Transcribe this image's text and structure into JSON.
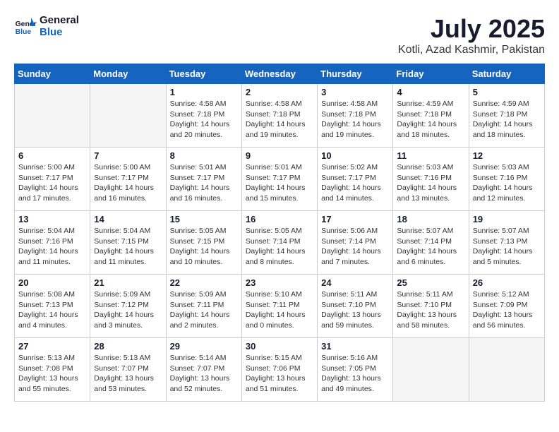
{
  "header": {
    "logo_line1": "General",
    "logo_line2": "Blue",
    "month": "July 2025",
    "location": "Kotli, Azad Kashmir, Pakistan"
  },
  "weekdays": [
    "Sunday",
    "Monday",
    "Tuesday",
    "Wednesday",
    "Thursday",
    "Friday",
    "Saturday"
  ],
  "weeks": [
    [
      {
        "day": "",
        "info": ""
      },
      {
        "day": "",
        "info": ""
      },
      {
        "day": "1",
        "info": "Sunrise: 4:58 AM\nSunset: 7:18 PM\nDaylight: 14 hours\nand 20 minutes."
      },
      {
        "day": "2",
        "info": "Sunrise: 4:58 AM\nSunset: 7:18 PM\nDaylight: 14 hours\nand 19 minutes."
      },
      {
        "day": "3",
        "info": "Sunrise: 4:58 AM\nSunset: 7:18 PM\nDaylight: 14 hours\nand 19 minutes."
      },
      {
        "day": "4",
        "info": "Sunrise: 4:59 AM\nSunset: 7:18 PM\nDaylight: 14 hours\nand 18 minutes."
      },
      {
        "day": "5",
        "info": "Sunrise: 4:59 AM\nSunset: 7:18 PM\nDaylight: 14 hours\nand 18 minutes."
      }
    ],
    [
      {
        "day": "6",
        "info": "Sunrise: 5:00 AM\nSunset: 7:17 PM\nDaylight: 14 hours\nand 17 minutes."
      },
      {
        "day": "7",
        "info": "Sunrise: 5:00 AM\nSunset: 7:17 PM\nDaylight: 14 hours\nand 16 minutes."
      },
      {
        "day": "8",
        "info": "Sunrise: 5:01 AM\nSunset: 7:17 PM\nDaylight: 14 hours\nand 16 minutes."
      },
      {
        "day": "9",
        "info": "Sunrise: 5:01 AM\nSunset: 7:17 PM\nDaylight: 14 hours\nand 15 minutes."
      },
      {
        "day": "10",
        "info": "Sunrise: 5:02 AM\nSunset: 7:17 PM\nDaylight: 14 hours\nand 14 minutes."
      },
      {
        "day": "11",
        "info": "Sunrise: 5:03 AM\nSunset: 7:16 PM\nDaylight: 14 hours\nand 13 minutes."
      },
      {
        "day": "12",
        "info": "Sunrise: 5:03 AM\nSunset: 7:16 PM\nDaylight: 14 hours\nand 12 minutes."
      }
    ],
    [
      {
        "day": "13",
        "info": "Sunrise: 5:04 AM\nSunset: 7:16 PM\nDaylight: 14 hours\nand 11 minutes."
      },
      {
        "day": "14",
        "info": "Sunrise: 5:04 AM\nSunset: 7:15 PM\nDaylight: 14 hours\nand 11 minutes."
      },
      {
        "day": "15",
        "info": "Sunrise: 5:05 AM\nSunset: 7:15 PM\nDaylight: 14 hours\nand 10 minutes."
      },
      {
        "day": "16",
        "info": "Sunrise: 5:05 AM\nSunset: 7:14 PM\nDaylight: 14 hours\nand 8 minutes."
      },
      {
        "day": "17",
        "info": "Sunrise: 5:06 AM\nSunset: 7:14 PM\nDaylight: 14 hours\nand 7 minutes."
      },
      {
        "day": "18",
        "info": "Sunrise: 5:07 AM\nSunset: 7:14 PM\nDaylight: 14 hours\nand 6 minutes."
      },
      {
        "day": "19",
        "info": "Sunrise: 5:07 AM\nSunset: 7:13 PM\nDaylight: 14 hours\nand 5 minutes."
      }
    ],
    [
      {
        "day": "20",
        "info": "Sunrise: 5:08 AM\nSunset: 7:13 PM\nDaylight: 14 hours\nand 4 minutes."
      },
      {
        "day": "21",
        "info": "Sunrise: 5:09 AM\nSunset: 7:12 PM\nDaylight: 14 hours\nand 3 minutes."
      },
      {
        "day": "22",
        "info": "Sunrise: 5:09 AM\nSunset: 7:11 PM\nDaylight: 14 hours\nand 2 minutes."
      },
      {
        "day": "23",
        "info": "Sunrise: 5:10 AM\nSunset: 7:11 PM\nDaylight: 14 hours\nand 0 minutes."
      },
      {
        "day": "24",
        "info": "Sunrise: 5:11 AM\nSunset: 7:10 PM\nDaylight: 13 hours\nand 59 minutes."
      },
      {
        "day": "25",
        "info": "Sunrise: 5:11 AM\nSunset: 7:10 PM\nDaylight: 13 hours\nand 58 minutes."
      },
      {
        "day": "26",
        "info": "Sunrise: 5:12 AM\nSunset: 7:09 PM\nDaylight: 13 hours\nand 56 minutes."
      }
    ],
    [
      {
        "day": "27",
        "info": "Sunrise: 5:13 AM\nSunset: 7:08 PM\nDaylight: 13 hours\nand 55 minutes."
      },
      {
        "day": "28",
        "info": "Sunrise: 5:13 AM\nSunset: 7:07 PM\nDaylight: 13 hours\nand 53 minutes."
      },
      {
        "day": "29",
        "info": "Sunrise: 5:14 AM\nSunset: 7:07 PM\nDaylight: 13 hours\nand 52 minutes."
      },
      {
        "day": "30",
        "info": "Sunrise: 5:15 AM\nSunset: 7:06 PM\nDaylight: 13 hours\nand 51 minutes."
      },
      {
        "day": "31",
        "info": "Sunrise: 5:16 AM\nSunset: 7:05 PM\nDaylight: 13 hours\nand 49 minutes."
      },
      {
        "day": "",
        "info": ""
      },
      {
        "day": "",
        "info": ""
      }
    ]
  ]
}
